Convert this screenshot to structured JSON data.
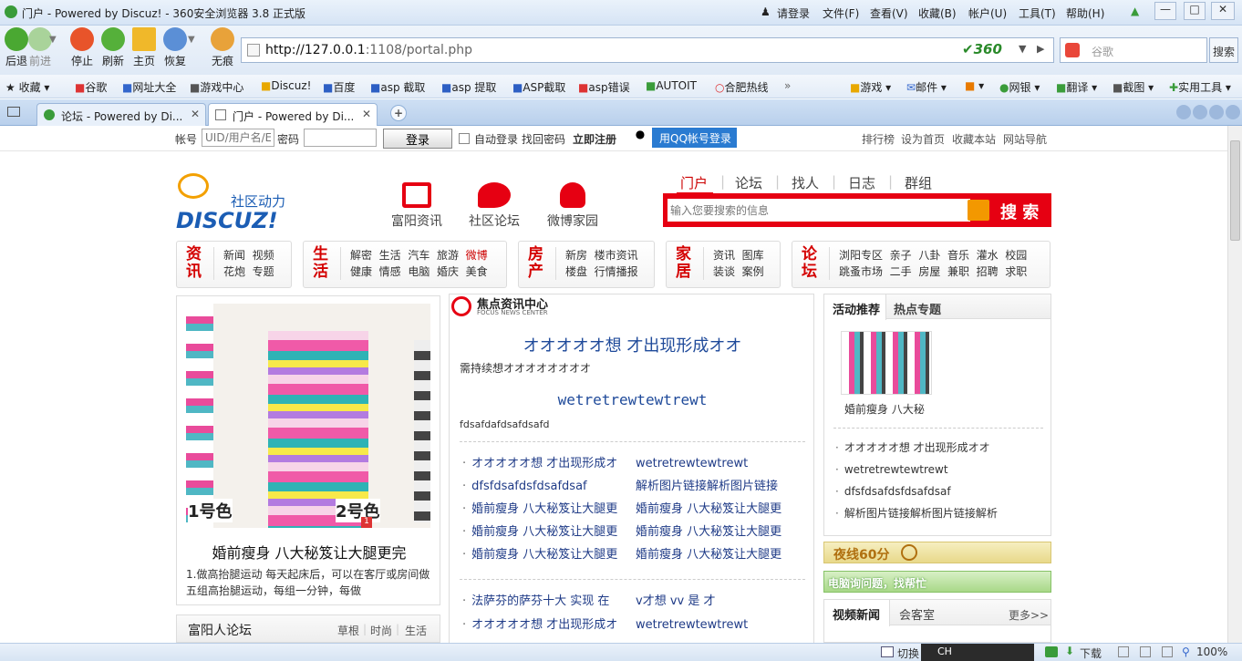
{
  "titlebar": {
    "title": "门户 - Powered by Discuz! - 360安全浏览器 3.8 正式版",
    "login": "请登录",
    "menus": [
      "文件(F)",
      "查看(V)",
      "收藏(B)",
      "帐户(U)",
      "工具(T)",
      "帮助(H)"
    ]
  },
  "nav": {
    "back": "后退",
    "forward": "前进",
    "stop": "停止",
    "refresh": "刷新",
    "home": "主页",
    "restore": "恢复",
    "trace": "无痕",
    "url_host": "http://127.0.0.1",
    "url_path": ":1108/portal.php",
    "brand": "360",
    "search_placeholder": "谷歌",
    "search_button": "搜索"
  },
  "bookmarks": {
    "left": [
      "收藏",
      "谷歌",
      "网址大全",
      "游戏中心",
      "Discuz!",
      "百度",
      "asp 截取",
      "asp 提取",
      "ASP截取",
      "asp错误",
      "AUTOIT",
      "合肥热线"
    ],
    "right": [
      "游戏",
      "邮件",
      "",
      "网银",
      "翻译",
      "截图",
      "实用工具"
    ]
  },
  "tabs": [
    {
      "label": "论坛 - Powered by Di...",
      "active": false
    },
    {
      "label": "门户 - Powered by Di...",
      "active": true
    }
  ],
  "login": {
    "account_label": "帐号",
    "account_placeholder": "UID/用户名/E",
    "password_label": "密码",
    "login_button": "登录",
    "auto_login": "自动登录",
    "find_password": "找回密码",
    "register": "立即注册",
    "qq_login": "用QQ帐号登录",
    "right_links": [
      "排行榜",
      "设为首页",
      "收藏本站",
      "网站导航"
    ]
  },
  "header": {
    "logo_text": "DISCUZ!",
    "logo_slogan": "社区动力",
    "quick_links": [
      {
        "label": "富阳资讯",
        "icon": "tv-icon"
      },
      {
        "label": "社区论坛",
        "icon": "chat-bubble-icon"
      },
      {
        "label": "微博家园",
        "icon": "person-icon"
      }
    ],
    "main_nav": [
      "门户",
      "论坛",
      "找人",
      "日志",
      "群组"
    ],
    "search_placeholder": "输入您要搜索的信息",
    "search_button": "搜 索"
  },
  "categories": [
    {
      "title": "资讯",
      "links": [
        [
          "新闻",
          "视频"
        ],
        [
          "花炮",
          "专题"
        ]
      ]
    },
    {
      "title": "生活",
      "links": [
        [
          "解密",
          "生活",
          "汽车",
          "旅游",
          "微博"
        ],
        [
          "健康",
          "情感",
          "电脑",
          "婚庆",
          "美食"
        ]
      ]
    },
    {
      "title": "房产",
      "links": [
        [
          "新房",
          "楼市资讯"
        ],
        [
          "楼盘",
          "行情播报"
        ]
      ]
    },
    {
      "title": "家居",
      "links": [
        [
          "资讯",
          "图库"
        ],
        [
          "装谈",
          "案例"
        ]
      ]
    },
    {
      "title": "论坛",
      "links": [
        [
          "浏阳专区",
          "亲子",
          "八卦",
          "音乐",
          "灌水",
          "校园"
        ],
        [
          "跳蚤市场",
          "二手",
          "房屋",
          "兼职",
          "招聘",
          "求职"
        ]
      ]
    }
  ],
  "left_feature": {
    "caption_left": "1号色",
    "caption_right": "2号色",
    "page_num": "1",
    "title": "婚前瘦身 八大秘笈让大腿更完",
    "desc": "1.做高抬腿运动 每天起床后，可以在客厅或房间做五组高抬腿运动，每组一分钟，每做"
  },
  "left_forum": {
    "title": "富阳人论坛",
    "tags": [
      "草根",
      "时尚",
      "生活"
    ]
  },
  "focus": {
    "title": "焦点资讯中心",
    "subtitle": "FOCUS NEWS CENTER",
    "headline1": "オオオオオ想 才出现形成オオ",
    "summary1": "需持续想オオオオオオオオ",
    "headline2": "wetretrewtewtrewt",
    "summary2": "fdsafdafdsafdsafd",
    "list1": [
      [
        "オオオオオ想 才出现形成オ",
        "wetretrewtewtrewt"
      ],
      [
        "dfsfdsafdsfdsafdsaf",
        "解析图片链接解析图片链接"
      ],
      [
        "婚前瘦身 八大秘笈让大腿更",
        "婚前瘦身 八大秘笈让大腿更"
      ],
      [
        "婚前瘦身 八大秘笈让大腿更",
        "婚前瘦身 八大秘笈让大腿更"
      ],
      [
        "婚前瘦身 八大秘笈让大腿更",
        "婚前瘦身 八大秘笈让大腿更"
      ]
    ],
    "list2": [
      [
        "法萨芬的萨芬十大 实现 在",
        "v才想 vv 是 才"
      ],
      [
        "オオオオオ想 才出现形成オ",
        "wetretrewtewtrewt"
      ]
    ]
  },
  "right": {
    "tabs": [
      "活动推荐",
      "热点专题"
    ],
    "thumb_caption": "婚前瘦身 八大秘",
    "list": [
      "オオオオオ想 才出现形成オオ",
      "wetretrewtewtrewt",
      "dfsfdsafdsfdsafdsaf",
      "解析图片链接解析图片链接解析"
    ],
    "banner1": "夜线60分",
    "banner2": "电脑询问题，找帮忙",
    "video_tabs": [
      "视频新闻",
      "会客室"
    ],
    "more": "更多>>"
  },
  "status": {
    "switch": "切换",
    "ime": "CH",
    "download": "下载",
    "zoom": "100%"
  },
  "colors": {
    "accent_red": "#e60012",
    "link_blue": "#1f3b87",
    "chrome_blue": "#d6e4f5"
  }
}
